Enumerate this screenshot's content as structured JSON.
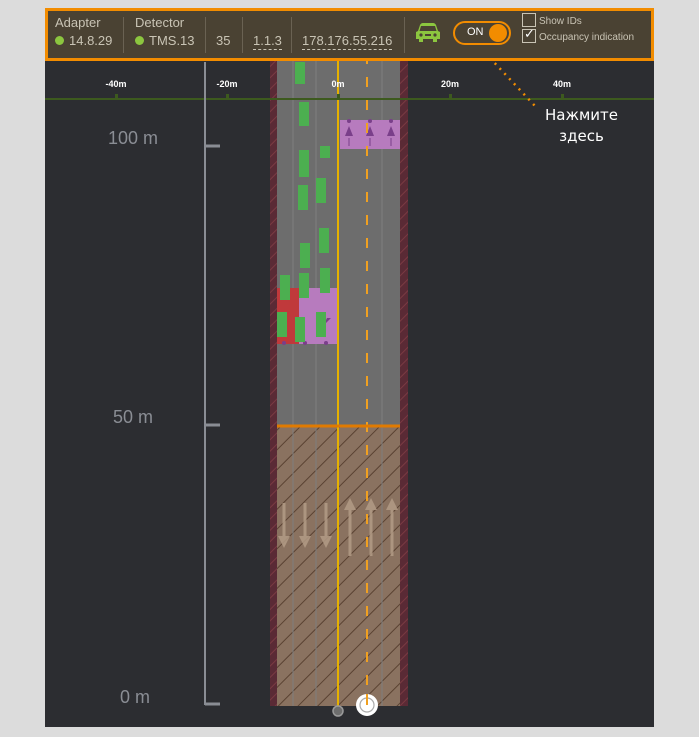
{
  "header": {
    "adapter": {
      "label": "Adapter",
      "status_color": "#8cc63f",
      "value": "14.8.29"
    },
    "detector": {
      "label": "Detector",
      "status_color": "#8cc63f",
      "value": "TMS.13"
    },
    "number": "35",
    "version": "1.1.3",
    "ip": "178.176.55.216",
    "vehicle_icon": "car-icon",
    "toggle": {
      "label": "ON",
      "state": true
    },
    "show_ids": {
      "label": "Show IDs",
      "checked": false
    },
    "occupancy_indication": {
      "label": "Occupancy indication",
      "checked": true
    }
  },
  "x_axis": {
    "ticks": [
      "-40m",
      "-20m",
      "0m",
      "20m",
      "40m"
    ]
  },
  "y_axis": {
    "labels": [
      "100 m",
      "50 m",
      "0 m"
    ]
  },
  "callout": {
    "line1": "Нажмите",
    "line2": "здесь"
  },
  "colors": {
    "accent": "#f28c00",
    "status_ok": "#8cc63f",
    "vehicle": "#4caf50",
    "occupancy_zone": "#b77bbe",
    "occupied_zone": "#c0393b",
    "center_line": "#e6b100",
    "road": "#6d6d6d"
  }
}
